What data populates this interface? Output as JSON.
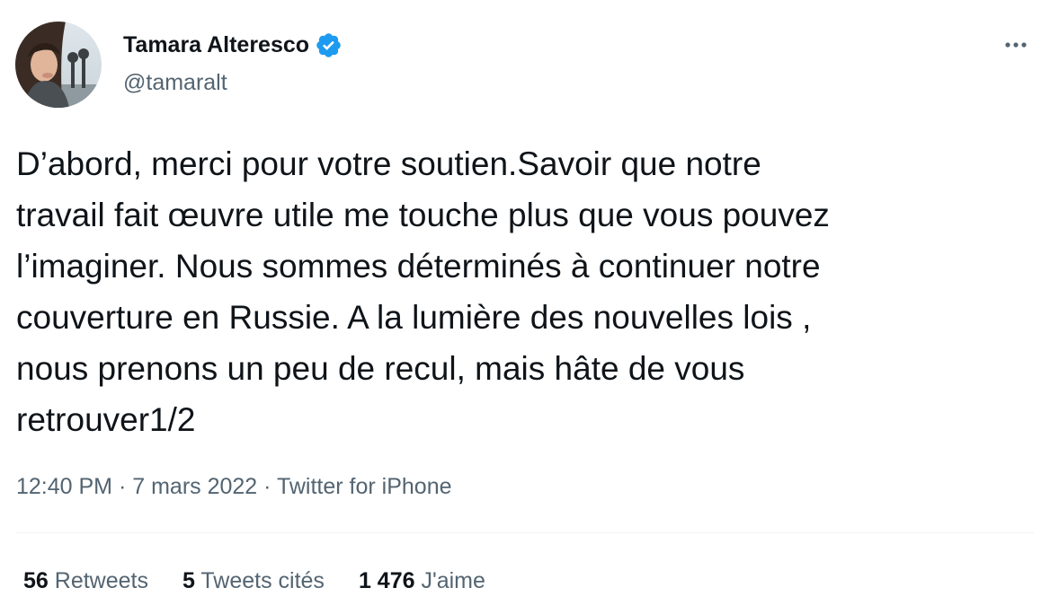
{
  "author": {
    "name": "Tamara Alteresco",
    "handle": "@tamaralt",
    "verified_icon": "verified-badge-icon",
    "avatar_icon": "profile-photo"
  },
  "tweet": {
    "text": "D’abord, merci pour votre soutien.Savoir que notre\ntravail fait œuvre utile me touche plus que vous pouvez\nl’imaginer. Nous sommes déterminés à continuer notre\ncouverture en Russie. A la lumière des nouvelles lois ,\nnous prenons un peu de recul, mais hâte de vous\nretrouver1/2",
    "time": "12:40 PM",
    "separator": " · ",
    "date": "7 mars 2022",
    "source": "Twitter for iPhone"
  },
  "stats": {
    "retweets_count": "56",
    "retweets_label": " Retweets",
    "quotes_count": "5",
    "quotes_label": " Tweets cités",
    "likes_count": "1 476",
    "likes_label": " J'aime"
  },
  "more_icon": "more-dots-icon",
  "colors": {
    "text_primary": "#0f1419",
    "text_secondary": "#536471",
    "verified_blue": "#1d9bf0",
    "divider": "#eff3f4"
  }
}
